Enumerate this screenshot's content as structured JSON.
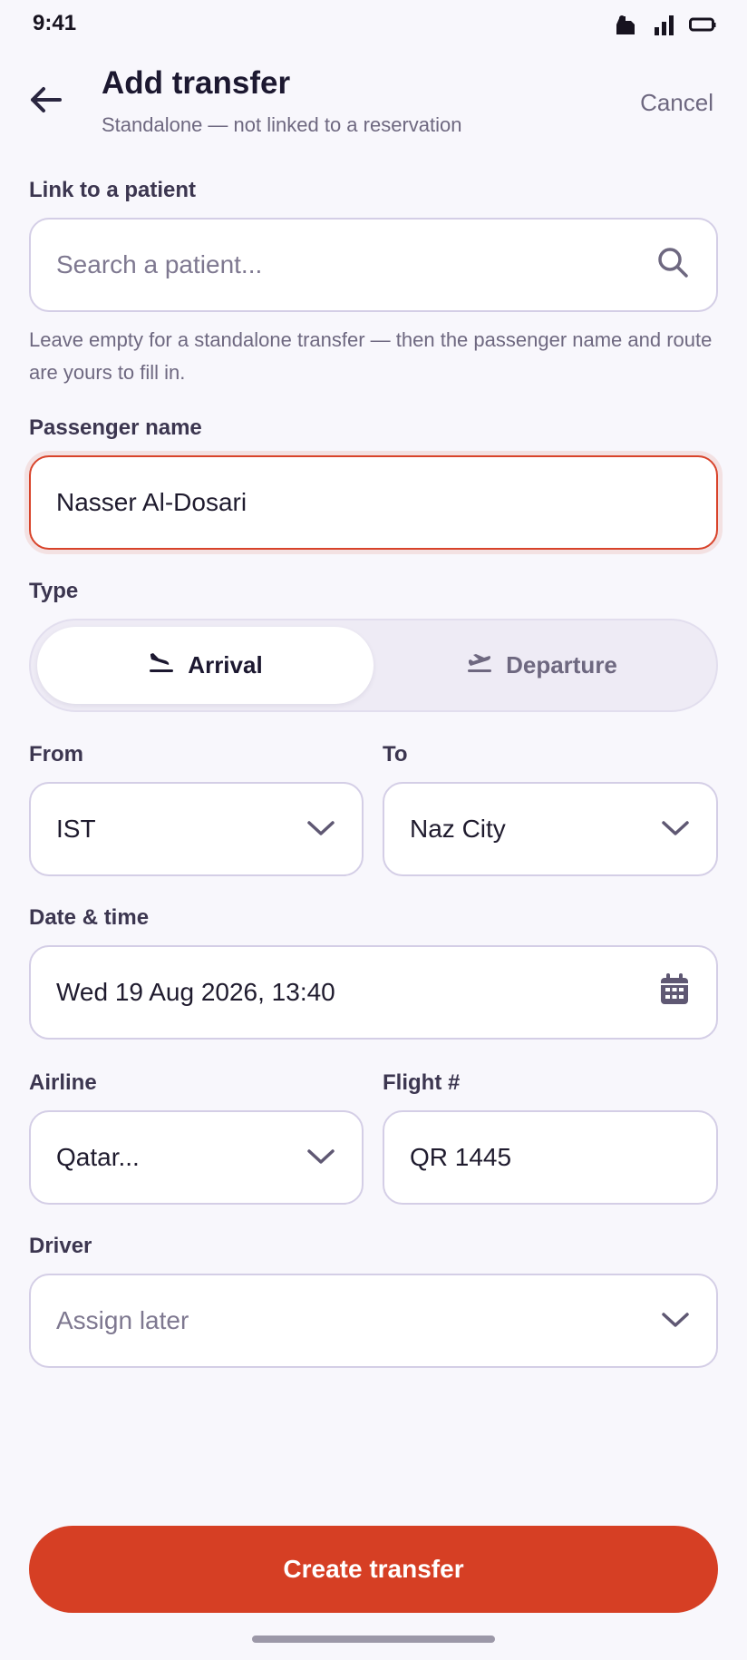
{
  "status_bar": {
    "time": "9:41"
  },
  "header": {
    "title": "Add transfer",
    "subtitle": "Standalone — not linked to a reservation",
    "cancel_label": "Cancel"
  },
  "patient": {
    "label": "Link to a patient",
    "placeholder": "Search a patient...",
    "value": "",
    "helper": "Leave empty for a standalone transfer — then the passenger name and route are yours to fill in."
  },
  "passenger": {
    "label": "Passenger name",
    "value": "Nasser Al-Dosari"
  },
  "type": {
    "label": "Type",
    "options": [
      {
        "label": "Arrival",
        "icon": "plane-landing-icon",
        "selected": true
      },
      {
        "label": "Departure",
        "icon": "plane-takeoff-icon",
        "selected": false
      }
    ]
  },
  "from": {
    "label": "From",
    "value": "IST"
  },
  "to": {
    "label": "To",
    "value": "Naz City"
  },
  "datetime": {
    "label": "Date & time",
    "value": "Wed 19 Aug 2026, 13:40"
  },
  "airline": {
    "label": "Airline",
    "value": "Qatar..."
  },
  "flight": {
    "label": "Flight #",
    "value": "QR 1445"
  },
  "driver": {
    "label": "Driver",
    "placeholder": "Assign later"
  },
  "actions": {
    "create_label": "Create transfer"
  },
  "colors": {
    "accent": "#D63F24",
    "background": "#F8F7FC",
    "border": "#D4CEE6",
    "muted_text": "#6E6880"
  }
}
